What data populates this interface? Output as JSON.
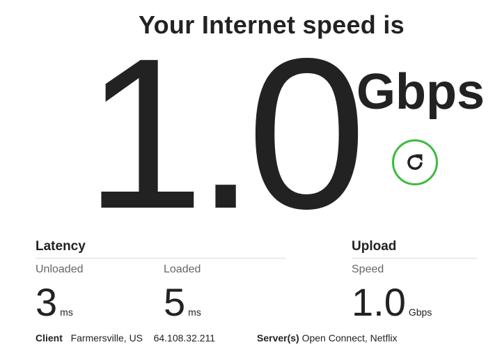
{
  "header": {
    "title": "Your Internet speed is"
  },
  "download": {
    "value": "1.0",
    "unit": "Gbps"
  },
  "refresh": {
    "icon": "refresh-icon",
    "color": "#3dbb3d"
  },
  "latency": {
    "title": "Latency",
    "unloaded_label": "Unloaded",
    "unloaded_value": "3",
    "unloaded_unit": "ms",
    "loaded_label": "Loaded",
    "loaded_value": "5",
    "loaded_unit": "ms"
  },
  "upload": {
    "title": "Upload",
    "speed_label": "Speed",
    "value": "1.0",
    "unit": "Gbps"
  },
  "footer": {
    "client_label": "Client",
    "client_location": "Farmersville, US",
    "client_ip": "64.108.32.211",
    "servers_label": "Server(s)",
    "servers_value": "Open Connect, Netflix"
  }
}
